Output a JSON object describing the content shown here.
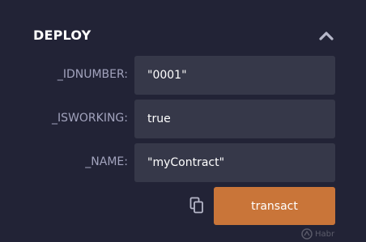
{
  "deploy": {
    "title": "DEPLOY",
    "fields": [
      {
        "label": "_IDNUMBER:",
        "value": "\"0001\""
      },
      {
        "label": "_ISWORKING:",
        "value": "true"
      },
      {
        "label": "_NAME:",
        "value": "\"myContract\""
      }
    ],
    "transact_label": "transact"
  },
  "icons": {
    "collapse": "chevron-up-icon",
    "copy": "copy-icon"
  },
  "watermark_text": "Habr",
  "colors": {
    "background": "#222336",
    "input_background": "#363849",
    "label_text": "#a2a3bd",
    "button_accent": "#c97539"
  }
}
